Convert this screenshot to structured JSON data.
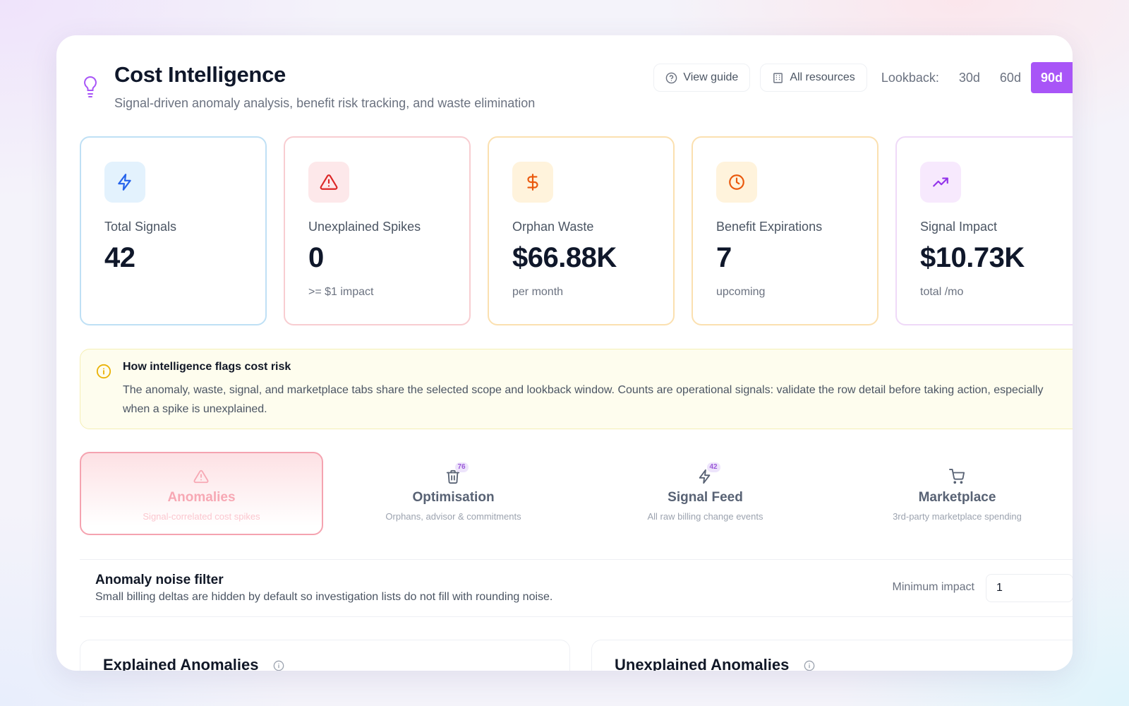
{
  "header": {
    "title": "Cost Intelligence",
    "subtitle": "Signal-driven anomaly analysis, benefit risk tracking, and waste elimination",
    "view_guide_label": "View guide",
    "scope_label": "All resources",
    "lookback_label": "Lookback:",
    "lookback_options": [
      "30d",
      "60d",
      "90d"
    ],
    "lookback_selected": "90d"
  },
  "stats": [
    {
      "icon": "lightning-icon",
      "label": "Total Signals",
      "value": "42",
      "sub": "",
      "color": "#2563eb"
    },
    {
      "icon": "warning-triangle-icon",
      "label": "Unexplained Spikes",
      "value": "0",
      "sub": ">= $1 impact",
      "color": "#dc2626"
    },
    {
      "icon": "dollar-icon",
      "label": "Orphan Waste",
      "value": "$66.88K",
      "sub": "per month",
      "color": "#ea580c"
    },
    {
      "icon": "clock-icon",
      "label": "Benefit Expirations",
      "value": "7",
      "sub": "upcoming",
      "color": "#ea580c"
    },
    {
      "icon": "trending-up-icon",
      "label": "Signal Impact",
      "value": "$10.73K",
      "sub": "total /mo",
      "color": "#9333ea"
    }
  ],
  "info": {
    "title": "How intelligence flags cost risk",
    "body": "The anomaly, waste, signal, and marketplace tabs share the selected scope and lookback window. Counts are operational signals: validate the row detail before taking action, especially when a spike is unexplained."
  },
  "tabs": [
    {
      "icon": "warning-triangle-icon",
      "label": "Anomalies",
      "sub": "Signal-correlated cost spikes",
      "badge": "",
      "active": true
    },
    {
      "icon": "trash-icon",
      "label": "Optimisation",
      "sub": "Orphans, advisor & commitments",
      "badge": "76",
      "active": false
    },
    {
      "icon": "lightning-icon",
      "label": "Signal Feed",
      "sub": "All raw billing change events",
      "badge": "42",
      "active": false
    },
    {
      "icon": "cart-icon",
      "label": "Marketplace",
      "sub": "3rd-party marketplace spending",
      "badge": "",
      "active": false
    }
  ],
  "noise_filter": {
    "title": "Anomaly noise filter",
    "description": "Small billing deltas are hidden by default so investigation lists do not fill with rounding noise.",
    "min_impact_label": "Minimum impact",
    "min_impact_value": "1"
  },
  "panels": {
    "explained_title": "Explained Anomalies",
    "unexplained_title": "Unexplained Anomalies"
  },
  "colors": {
    "accent": "#a855f7",
    "active_tab_border": "#f5a3b0",
    "banner_bg": "#fefdee"
  }
}
